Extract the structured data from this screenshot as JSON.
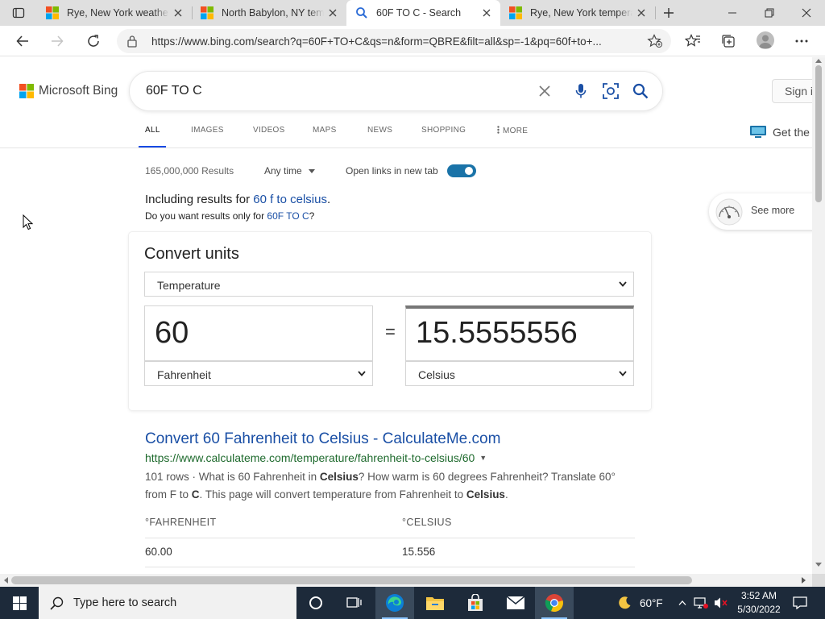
{
  "browser": {
    "tabs": [
      {
        "title": "Rye, New York weather",
        "favicon": "msn-icon",
        "active": false
      },
      {
        "title": "North Babylon, NY tem",
        "favicon": "msn-icon",
        "active": false
      },
      {
        "title": "60F TO C - Search",
        "favicon": "bing-search-icon",
        "active": true
      },
      {
        "title": "Rye, New York tempera",
        "favicon": "msn-icon",
        "active": false
      }
    ],
    "url": "https://www.bing.com/search?q=60F+TO+C&qs=n&form=QBRE&filt=all&sp=-1&pq=60f+to+..."
  },
  "bing": {
    "logo_text": "Microsoft Bing",
    "query": "60F TO C",
    "signin_label": "Sign i",
    "nav": [
      "ALL",
      "IMAGES",
      "VIDEOS",
      "MAPS",
      "NEWS",
      "SHOPPING",
      "MORE"
    ],
    "get_the": "Get the",
    "accent": "#174ae4"
  },
  "meta": {
    "results_count": "165,000,000 Results",
    "any_time": "Any time",
    "open_links": "Open links in new tab",
    "open_links_enabled": true
  },
  "spelling": {
    "including_prefix": "Including results for ",
    "including_link": "60 f to celsius",
    "including_suffix": ".",
    "only_prefix": "Do you want results only for ",
    "only_link": "60F TO C",
    "only_suffix": "?"
  },
  "see_more": "See more",
  "converter": {
    "heading": "Convert units",
    "category": "Temperature",
    "from_value": "60",
    "from_unit": "Fahrenheit",
    "equals": "=",
    "to_value": "15.5555556",
    "to_unit": "Celsius"
  },
  "result": {
    "title": "Convert 60 Fahrenheit to Celsius - CalculateMe.com",
    "url": "https://www.calculateme.com/temperature/fahrenheit-to-celsius/60",
    "snippet_parts": {
      "p1": "101 rows · What is 60 Fahrenheit in ",
      "b1": "Celsius",
      "p2": "? How warm is 60 degrees Fahrenheit? Translate 60° from F to ",
      "b2": "C",
      "p3": ". This page will convert temperature from Fahrenheit to ",
      "b3": "Celsius",
      "p4": "."
    },
    "table_headers": [
      "°FAHRENHEIT",
      "°CELSIUS"
    ],
    "table_row": [
      "60.00",
      "15.556"
    ]
  },
  "taskbar": {
    "search_placeholder": "Type here to search",
    "weather": "60°F",
    "time": "3:52 AM",
    "date": "5/30/2022"
  }
}
